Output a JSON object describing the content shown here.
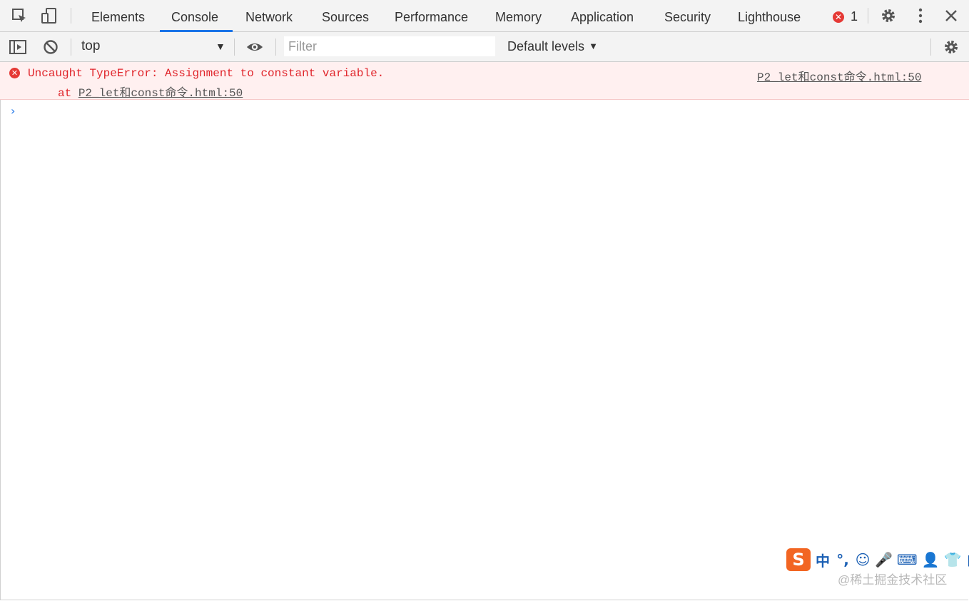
{
  "tabs": [
    {
      "label": "Elements",
      "active": false
    },
    {
      "label": "Console",
      "active": true
    },
    {
      "label": "Network",
      "active": false
    },
    {
      "label": "Sources",
      "active": false
    },
    {
      "label": "Performance",
      "active": false
    },
    {
      "label": "Memory",
      "active": false
    },
    {
      "label": "Application",
      "active": false
    },
    {
      "label": "Security",
      "active": false
    },
    {
      "label": "Lighthouse",
      "active": false
    }
  ],
  "error_count": "1",
  "toolbar": {
    "context": "top",
    "filter_placeholder": "Filter",
    "levels": "Default levels"
  },
  "console": {
    "error_message": "Uncaught TypeError: Assignment to constant variable.",
    "stack_prefix": "at ",
    "stack_link": "P2_let和const命令.html:50",
    "source_link": "P2_let和const命令.html:50",
    "prompt": "›"
  },
  "ime": {
    "logo": "S",
    "items": [
      "中",
      "°,",
      "☺",
      "🎤",
      "⌨",
      "👤",
      "👕",
      "▦"
    ]
  },
  "watermark": "@稀土掘金技术社区",
  "colors": {
    "accent": "#1a73e8",
    "error": "#e0252b",
    "error_bg": "#fff0f0",
    "ime_brand": "#f26522"
  }
}
